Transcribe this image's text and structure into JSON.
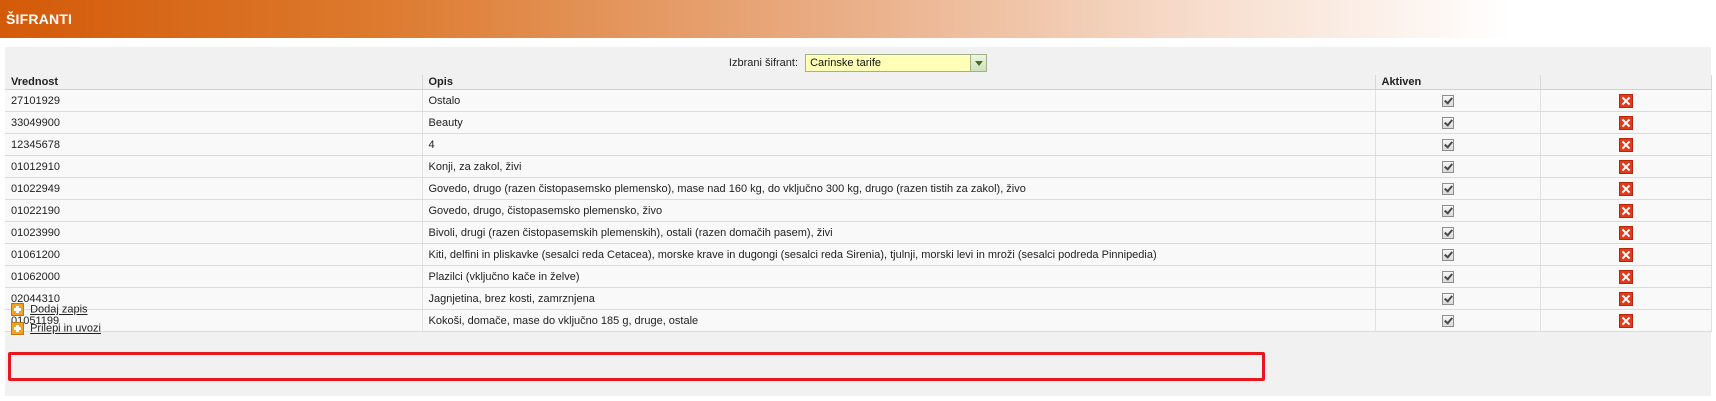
{
  "header": {
    "title": "ŠIFRANTI"
  },
  "selector": {
    "label": "Izbrani šifrant:",
    "value": "Carinske tarife"
  },
  "table": {
    "columns": {
      "vrednost": "Vrednost",
      "opis": "Opis",
      "aktiven": "Aktiven",
      "actions": ""
    },
    "rows": [
      {
        "vrednost": "27101929",
        "opis": "Ostalo",
        "aktiven": true
      },
      {
        "vrednost": "33049900",
        "opis": "Beauty",
        "aktiven": true
      },
      {
        "vrednost": "12345678",
        "opis": "4",
        "aktiven": true
      },
      {
        "vrednost": "01012910",
        "opis": "Konji, za zakol, živi",
        "aktiven": true
      },
      {
        "vrednost": "01022949",
        "opis": "Govedo, drugo (razen čistopasemsko plemensko), mase nad 160 kg, do vključno 300 kg, drugo (razen tistih za zakol), živo",
        "aktiven": true
      },
      {
        "vrednost": "01022190",
        "opis": "Govedo, drugo, čistopasemsko plemensko, živo",
        "aktiven": true
      },
      {
        "vrednost": "01023990",
        "opis": "Bivoli, drugi (razen čistopasemskih plemenskih), ostali (razen domačih pasem), živi",
        "aktiven": true
      },
      {
        "vrednost": "01061200",
        "opis": "Kiti, delfini in pliskavke (sesalci reda Cetacea), morske krave in dugongi (sesalci reda Sirenia), tjulnji, morski levi in mroži (sesalci podreda Pinnipedia)",
        "aktiven": true
      },
      {
        "vrednost": "01062000",
        "opis": "Plazilci (vključno kače in želve)",
        "aktiven": true
      },
      {
        "vrednost": "02044310",
        "opis": "Jagnjetina, brez kosti, zamrznjena",
        "aktiven": true
      },
      {
        "vrednost": "01051199",
        "opis": "Kokoši, domače, mase do vključno 185 g, druge, ostale",
        "aktiven": true
      }
    ]
  },
  "actions": {
    "add_record": "Dodaj zapis",
    "paste_import": "Prilepi in uvozi"
  },
  "icons": {
    "delete": "delete-icon",
    "add": "plus-icon",
    "dropdown": "chevron-down-icon"
  },
  "colors": {
    "accent": "#d35a08",
    "highlight": "#e8161d",
    "delete": "#e23a1a"
  }
}
